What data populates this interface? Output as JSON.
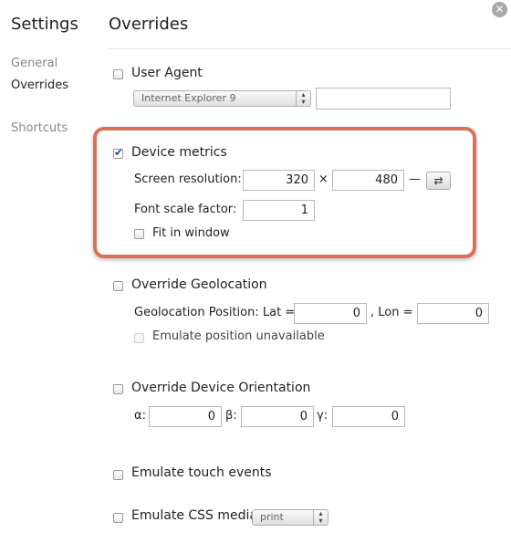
{
  "sidebar": {
    "title": "Settings",
    "items": [
      {
        "label": "General"
      },
      {
        "label": "Overrides"
      },
      {
        "label": "Shortcuts"
      }
    ]
  },
  "main": {
    "title": "Overrides",
    "user_agent": {
      "label": "User Agent",
      "checked": false,
      "select_value": "Internet Explorer 9",
      "custom_value": ""
    },
    "device_metrics": {
      "label": "Device metrics",
      "checked": true,
      "screen_resolution_label": "Screen resolution:",
      "width": "320",
      "times": "×",
      "height": "480",
      "dash": "—",
      "swap_icon": "⇄",
      "font_scale_label": "Font scale factor:",
      "font_scale": "1",
      "fit_in_window_label": "Fit in window"
    },
    "geolocation": {
      "label": "Override Geolocation",
      "position_label": "Geolocation Position: Lat =",
      "lat": "0",
      "lon_label": ", Lon =",
      "lon": "0",
      "unavailable_label": "Emulate position unavailable"
    },
    "orientation": {
      "label": "Override Device Orientation",
      "alpha_label": "α:",
      "alpha": "0",
      "beta_label": "β:",
      "beta": "0",
      "gamma_label": "γ:",
      "gamma": "0"
    },
    "touch": {
      "label": "Emulate touch events"
    },
    "css_media": {
      "label": "Emulate CSS media",
      "select_value": "print"
    }
  },
  "colors": {
    "highlight": "#dc6f55",
    "checkmark": "#1e4fa0"
  }
}
